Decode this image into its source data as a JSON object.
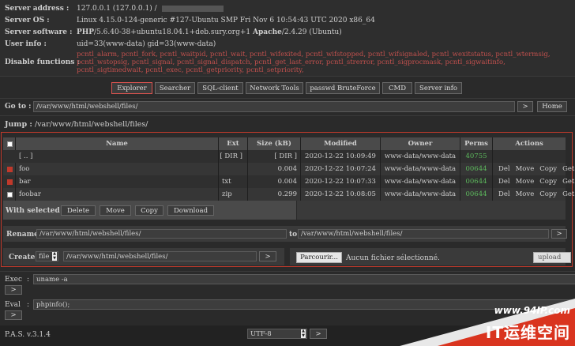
{
  "server_info": [
    {
      "label": "Server address :",
      "value": "127.0.0.1 (127.0.0.1) / "
    },
    {
      "label": "Server OS :",
      "value": "Linux 4.15.0-124-generic #127-Ubuntu SMP Fri Nov 6 10:54:43 UTC 2020 x86_64"
    },
    {
      "label": "Server software :",
      "value_php_label": "PHP",
      "value_php": "/5.6.40-38+ubuntu18.04.1+deb.sury.org+1 ",
      "value_apache_label": "Apache",
      "value_apache": "/2.4.29 (Ubuntu)"
    },
    {
      "label": "User info :",
      "value": "uid=33(www-data) gid=33(www-data)"
    },
    {
      "label": "Disable functions :",
      "value": "pcntl_alarm, pcntl_fork, pcntl_waitpid, pcntl_wait, pcntl_wifexited, pcntl_wifstopped, pcntl_wifsignaled, pcntl_wexitstatus, pcntl_wtermsig, pcntl_wstopsig, pcntl_signal, pcntl_signal_dispatch, pcntl_get_last_error, pcntl_strerror, pcntl_sigprocmask, pcntl_sigwaitinfo, pcntl_sigtimedwait, pcntl_exec, pcntl_getpriority, pcntl_setpriority,"
    }
  ],
  "tabs": [
    "Explorer",
    "Searcher",
    "SQL-client",
    "Network Tools",
    "passwd BruteForce",
    "CMD",
    "Server info"
  ],
  "goto": {
    "label": "Go to :",
    "value": "/var/www/html/webshell/files/",
    "go": ">",
    "home": "Home"
  },
  "jump": {
    "label": "Jump :",
    "path": "/var/www/html/webshell/files/"
  },
  "table": {
    "headers": [
      "Name",
      "Ext",
      "Size (kB)",
      "Modified",
      "Owner",
      "Perms",
      "Actions"
    ],
    "rows": [
      {
        "name": "[ .. ]",
        "ext": "[ DIR ]",
        "size": "[ DIR ]",
        "modified": "2020-12-22 10:09:49",
        "owner": "www-data/www-data",
        "perms": "40755",
        "checked": false,
        "has_check": false,
        "actions": []
      },
      {
        "name": "foo",
        "ext": "",
        "size": "0.004",
        "modified": "2020-12-22 10:07:24",
        "owner": "www-data/www-data",
        "perms": "00644",
        "checked": true,
        "has_check": true,
        "actions": [
          "Del",
          "Move",
          "Copy",
          "Get"
        ]
      },
      {
        "name": "bar",
        "ext": "txt",
        "size": "0.004",
        "modified": "2020-12-22 10:07:33",
        "owner": "www-data/www-data",
        "perms": "00644",
        "checked": true,
        "has_check": true,
        "actions": [
          "Del",
          "Move",
          "Copy",
          "Get"
        ]
      },
      {
        "name": "foobar",
        "ext": "zip",
        "size": "0.299",
        "modified": "2020-12-22 10:08:05",
        "owner": "www-data/www-data",
        "perms": "00644",
        "checked": false,
        "has_check": true,
        "actions": [
          "Del",
          "Move",
          "Copy",
          "Get"
        ]
      }
    ]
  },
  "with_selected": {
    "label": "With selected :",
    "buttons": [
      "Delete",
      "Move",
      "Copy",
      "Download"
    ]
  },
  "rename": {
    "label": "Rename",
    "from": "/var/www/html/webshell/files/",
    "to_label": "to",
    "to": "/var/www/html/webshell/files/",
    "go": ">"
  },
  "create": {
    "label": "Create",
    "type": "file",
    "path": "/var/www/html/webshell/files/",
    "go": ">"
  },
  "upload": {
    "browse": "Parcourir...",
    "status": "Aucun fichier sélectionné.",
    "button": "upload"
  },
  "exec": {
    "label": "Exec",
    "colon": ":",
    "value": "uname -a",
    "go": ">"
  },
  "eval": {
    "label": "Eval",
    "colon": ":",
    "value": "phpinfo();",
    "go": ">"
  },
  "footer": {
    "version": "P.A.S. v.3.1.4",
    "encoding": "UTF-8",
    "go": ">"
  },
  "watermark": {
    "url": "www.94IP.com",
    "text": "IT运维空间"
  },
  "colors": {
    "accent_red": "#c0504d",
    "perm_green": "#5cb85c",
    "background": "#2a2a2a"
  }
}
